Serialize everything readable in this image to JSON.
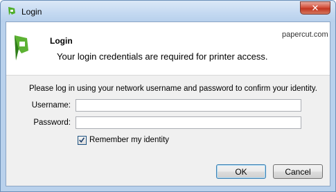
{
  "window": {
    "title": "Login",
    "close_label": "✕"
  },
  "header": {
    "title": "Login",
    "brand": "papercut.com",
    "message": "Your login credentials are required for printer access."
  },
  "form": {
    "instruction": "Please log in using your network username and password to confirm your identity.",
    "username_label": "Username:",
    "username_value": "",
    "password_label": "Password:",
    "password_value": "",
    "remember_label": "Remember my identity",
    "remember_checked": true
  },
  "buttons": {
    "ok": "OK",
    "cancel": "Cancel"
  },
  "colors": {
    "logo_green": "#5cb233",
    "logo_dark": "#2f7d1a"
  },
  "icons": {
    "app": "papercut-logo-icon",
    "close": "close-icon",
    "check": "checkmark-icon"
  }
}
